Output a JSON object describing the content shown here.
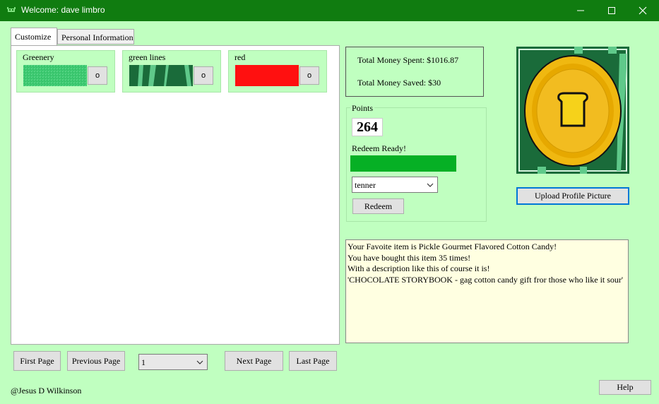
{
  "window": {
    "title": "Welcome: dave limbro",
    "controls": {
      "minimize_icon": "minimize-icon",
      "maximize_icon": "maximize-icon",
      "close_icon": "close-icon"
    }
  },
  "tabs": [
    {
      "label": "Customize",
      "active": true
    },
    {
      "label": "Personal Information",
      "active": false
    }
  ],
  "items": [
    {
      "label": "Greenery",
      "button": "o",
      "swatch": "speckled-green"
    },
    {
      "label": "green lines",
      "button": "o",
      "swatch": "green-stripes"
    },
    {
      "label": "red",
      "button": "o",
      "swatch": "solid-red"
    }
  ],
  "pagination": {
    "first": "First Page",
    "previous": "Previous Page",
    "page_value": "1",
    "next": "Next Page",
    "last": "Last Page"
  },
  "money": {
    "spent": "Total Money Spent: $1016.87",
    "saved": "Total Money Saved: $30"
  },
  "points": {
    "group_label": "Points",
    "value": "264",
    "redeem_status": "Redeem Ready!",
    "progress_fraction": 1.0,
    "reward_select": "tenner",
    "redeem_button": "Redeem"
  },
  "profile": {
    "upload_button": "Upload Profile Picture",
    "avatar_icon": "coin-with-toast-icon"
  },
  "favorite_info": {
    "lines": [
      "Your Favoite item is Pickle Gourmet Flavored Cotton Candy!",
      "You have bought this item 35 times!",
      "With a description like this of course it is!",
      "'CHOCOLATE STORYBOOK - gag cotton candy gift fror those who like it sour'"
    ]
  },
  "footer": {
    "credit": "@Jesus D Wilkinson",
    "help": "Help"
  },
  "colors": {
    "title_bar": "#107c10",
    "background": "#c0ffc0",
    "progress": "#06b025",
    "red_swatch": "#ff1010",
    "coin": "#f0b810"
  }
}
